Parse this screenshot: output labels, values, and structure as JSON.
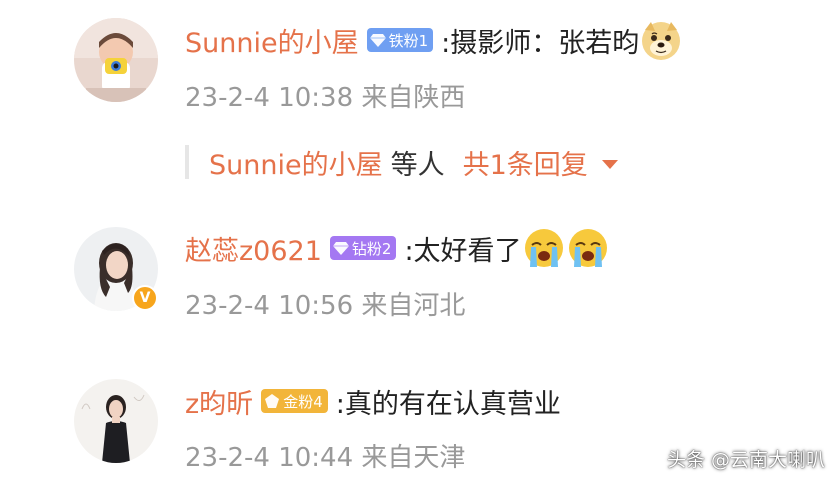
{
  "colors": {
    "username": "#e5724a",
    "meta": "#999999",
    "badge_iron": "#6f9ff2",
    "badge_diamond": "#a478f2",
    "badge_gold": "#f2b53a",
    "verified": "#f7a51c"
  },
  "comments": [
    {
      "username": "Sunnie的小屋",
      "badge": "铁粉1",
      "badge_icon": "diamond-gem-icon",
      "text": ":摄影师：张若昀",
      "emojis": [
        "doge-emoji"
      ],
      "meta": "23-2-4 10:38 来自陕西",
      "avatar": "avatar-child-with-camera",
      "verified": false,
      "reply": {
        "user": "Sunnie的小屋",
        "mid": "等人",
        "count": "共1条回复"
      }
    },
    {
      "username": "赵蕊z0621",
      "badge": "钻粉2",
      "badge_icon": "diamond-gem-icon",
      "text": ":太好看了",
      "emojis": [
        "crying-emoji",
        "crying-emoji"
      ],
      "meta": "23-2-4 10:56 来自河北",
      "avatar": "avatar-woman",
      "verified": true,
      "verified_symbol": "V"
    },
    {
      "username": "z昀昕",
      "badge": "金粉4",
      "badge_icon": "gold-gem-icon",
      "text": ":真的有在认真营业",
      "emojis": [],
      "meta": "23-2-4 10:44 来自天津",
      "avatar": "avatar-woman-dark-dress",
      "verified": false
    }
  ],
  "watermark": "头条 @云南大喇叭"
}
